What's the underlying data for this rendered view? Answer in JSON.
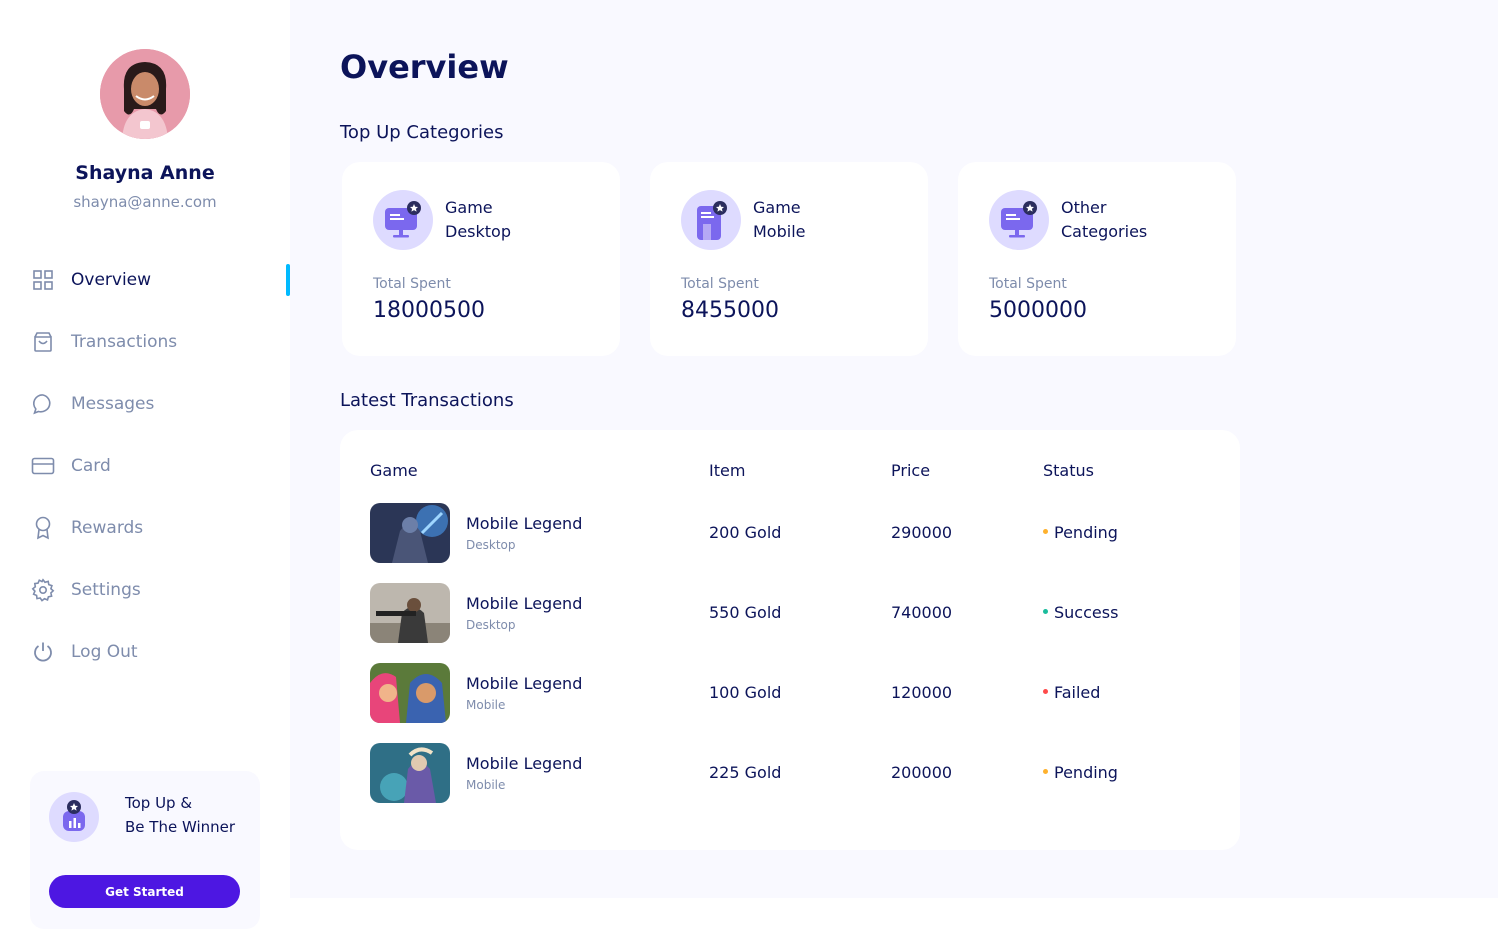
{
  "user": {
    "name": "Shayna Anne",
    "email": "shayna@anne.com"
  },
  "nav": [
    {
      "label": "Overview",
      "icon": "grid-icon"
    },
    {
      "label": "Transactions",
      "icon": "bag-icon"
    },
    {
      "label": "Messages",
      "icon": "chat-icon"
    },
    {
      "label": "Card",
      "icon": "card-icon"
    },
    {
      "label": "Rewards",
      "icon": "award-icon"
    },
    {
      "label": "Settings",
      "icon": "gear-icon"
    },
    {
      "label": "Log Out",
      "icon": "power-icon"
    }
  ],
  "active_nav": "Overview",
  "promo": {
    "line1": "Top Up &",
    "line2": "Be The Winner",
    "button": "Get Started"
  },
  "page_title": "Overview",
  "categories_title": "Top Up Categories",
  "categories": [
    {
      "line1": "Game",
      "line2": "Desktop",
      "total_label": "Total Spent",
      "total": "18000500",
      "icon": "desktop-icon"
    },
    {
      "line1": "Game",
      "line2": "Mobile",
      "total_label": "Total Spent",
      "total": "8455000",
      "icon": "mobile-icon"
    },
    {
      "line1": "Other",
      "line2": "Categories",
      "total_label": "Total Spent",
      "total": "5000000",
      "icon": "desktop-icon"
    }
  ],
  "transactions_title": "Latest Transactions",
  "table": {
    "headers": {
      "game": "Game",
      "item": "Item",
      "price": "Price",
      "status": "Status"
    },
    "rows": [
      {
        "game": "Mobile Legend",
        "platform": "Desktop",
        "item": "200 Gold",
        "price": "290000",
        "status": "Pending"
      },
      {
        "game": "Mobile Legend",
        "platform": "Desktop",
        "item": "550 Gold",
        "price": "740000",
        "status": "Success"
      },
      {
        "game": "Mobile Legend",
        "platform": "Mobile",
        "item": "100 Gold",
        "price": "120000",
        "status": "Failed"
      },
      {
        "game": "Mobile Legend",
        "platform": "Mobile",
        "item": "225 Gold",
        "price": "200000",
        "status": "Pending"
      }
    ]
  },
  "colors": {
    "primary_text": "#0c145a",
    "muted_text": "#7e8cac",
    "accent": "#4d17e2",
    "active_indicator": "#00baff",
    "icon_bg": "#dedbff",
    "status_pending": "#feb12d",
    "status_success": "#1abc9c",
    "status_failed": "#fe4a4a"
  }
}
